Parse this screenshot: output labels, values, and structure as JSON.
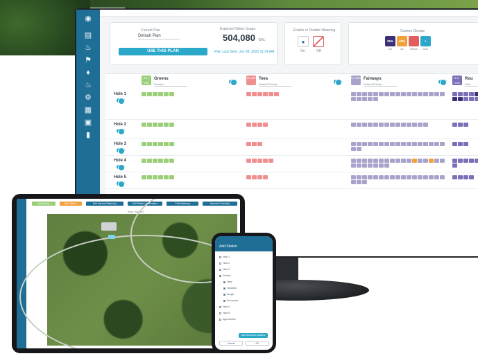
{
  "plan": {
    "current_plan_label": "Current Plan",
    "current_plan_value": "Default Plan",
    "use_plan_label": "USE THIS PLAN",
    "usage_label": "Expected Water Usage",
    "usage_value": "504,080",
    "usage_unit": "GAL",
    "last_sent": "Plan Last Sent: Jun 28, 2022 11:24 AM"
  },
  "watering": {
    "title": "Enable or Disable Watering",
    "on_label": "On",
    "off_label": "Off"
  },
  "groups": {
    "title": "Custom Groups",
    "items": [
      {
        "badge": "25%",
        "label": "wet",
        "color": "#3b2f7a"
      },
      {
        "badge": "40%",
        "label": "dry",
        "color": "#f0a13a"
      },
      {
        "badge": "",
        "label": "Default",
        "color": "#e25d5d"
      },
      {
        "badge": "+",
        "label": "ADD",
        "color": "#2aa7c9"
      }
    ]
  },
  "columns": [
    {
      "name": "Greens",
      "priority": "Priority 1",
      "badge": "8.17 MIN",
      "color": "#9bcf7a"
    },
    {
      "name": "Tees",
      "priority": "Default Priority",
      "badge": "15 MIN",
      "color": "#f08f8f"
    },
    {
      "name": "Fairways",
      "priority": "Default Priority",
      "badge": "8.2 MIN",
      "color": "#a9a3cc"
    },
    {
      "name": "Rou",
      "priority": "Defa",
      "badge": "8.17 MIN",
      "color": "#7a6fb8"
    }
  ],
  "holes": [
    {
      "label": "Hole 1"
    },
    {
      "label": "Hole 2"
    },
    {
      "label": "Hole 3"
    },
    {
      "label": "Hole 4"
    },
    {
      "label": "Hole 5"
    }
  ],
  "tablet": {
    "buttons": [
      "Start Stop",
      "Run Station",
      "Edit Manual Station(s)",
      "Edit Station Information",
      "Edit Watering",
      "Manual Control(s)"
    ],
    "subbar": "Wrap Standard"
  },
  "phone": {
    "title": "Add Station",
    "items": [
      "Hole 1",
      "Hole 2",
      "Hole 3",
      "Greens",
      "Tees",
      "Fairways",
      "Rough",
      "Surrounds",
      "Hole 4",
      "Hole 5",
      "Approaches"
    ],
    "primary_btn": "Add Selected Stations",
    "cancel_btn": "Cancel",
    "ok_btn": "OK"
  }
}
